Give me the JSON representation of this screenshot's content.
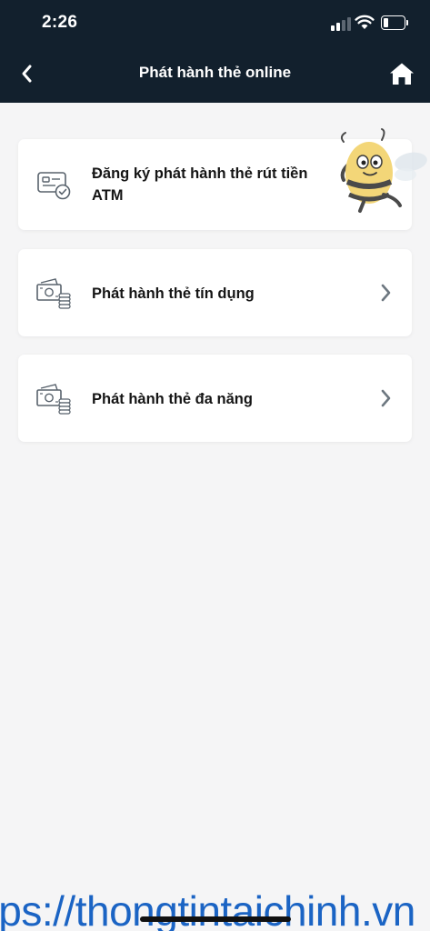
{
  "status_bar": {
    "time": "2:26",
    "signal_icon": "signal-bars-icon",
    "wifi_icon": "wifi-icon",
    "battery_icon": "battery-low-icon",
    "battery_level": 0.2
  },
  "header": {
    "title": "Phát hành thẻ online",
    "back_icon": "chevron-left-icon",
    "home_icon": "home-icon",
    "background": "#12202d"
  },
  "menu": {
    "items": [
      {
        "label_line1": "Đăng ký phát hành thẻ rút tiền",
        "label_line2": "ATM",
        "icon": "card-check-icon",
        "chevron": "chevron-right-icon"
      },
      {
        "label": "Phát hành thẻ tín dụng",
        "icon": "cash-coins-icon",
        "chevron": "chevron-right-icon"
      },
      {
        "label": "Phát hành thẻ đa năng",
        "icon": "cash-coins-icon",
        "chevron": "chevron-right-icon"
      }
    ]
  },
  "mascot": {
    "icon": "bee-mascot-icon"
  },
  "watermark": {
    "text": "tps://thongtintaichinh.vn",
    "color": "#1b64c4"
  }
}
